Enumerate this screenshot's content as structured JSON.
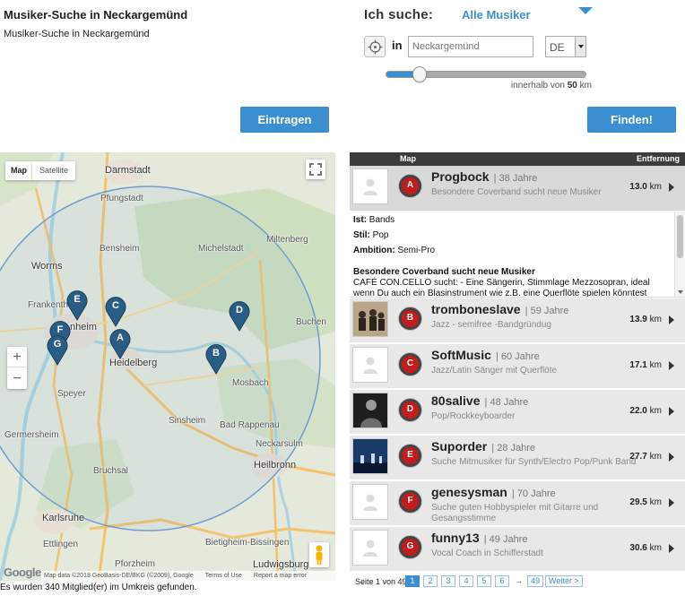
{
  "header": {
    "title": "Musiker-Suche in Neckargemünd",
    "subtitle": "Musiker-Suche in Neckargemünd"
  },
  "search": {
    "ich_suche_label": "Ich suche:",
    "category_value": "Alle Musiker",
    "in_label": "in",
    "location_placeholder": "Neckargemünd",
    "country_value": "DE",
    "radius_prefix": "innerhalb von",
    "radius_value": "50",
    "radius_unit": "km",
    "radius_fraction": 0.17,
    "eintragen_label": "Eintragen",
    "finden_label": "Finden!"
  },
  "map": {
    "type_map": "Map",
    "type_satellite": "Satellite",
    "zoom_in": "+",
    "zoom_out": "−",
    "google": "Google",
    "attribution": [
      "Map data ©2018 GeoBasis-DE/BKG (©2009), Google",
      "Terms of Use",
      "Report a map error"
    ],
    "cities": {
      "darmstadt": "Darmstadt",
      "pfungstadt": "Pfungstadt",
      "worms": "Worms",
      "bensheim": "Bensheim",
      "michelstadt": "Michelstadt",
      "miltenberg": "Miltenberg",
      "frankenthal": "Frankenth",
      "mannheim": "nheim",
      "heidelberg": "Heidelberg",
      "speyer": "Speyer",
      "mosbach": "Mosbach",
      "buchen": "Buchen",
      "sinsheim": "Sinsheim",
      "bad_rappenau": "Bad Rappenau",
      "germersheim": "Germersheim",
      "neckarsulm": "Neckarsulm",
      "bruchsal": "Bruchsal",
      "heilbronn": "Heilbronn",
      "karlsruhe": "Karlsruhe",
      "bietigheim": "Bietigheim-Bissingen",
      "ettlingen": "Ettlingen",
      "pforzheim": "Pforzheim",
      "ludwigsburg": "Ludwigsburg"
    },
    "pins": [
      "A",
      "B",
      "C",
      "D",
      "E",
      "F",
      "G"
    ]
  },
  "result_count_text": "Es wurden 340 Mitglied(er) im Umkreis gefunden.",
  "results": {
    "header_map": "Map",
    "header_distance": "Entfernung",
    "items": [
      {
        "letter": "A",
        "name": "Progbock",
        "age": "38 Jahre",
        "desc": "Besondere Coverband sucht neue Musiker",
        "dist": "13.0",
        "unit": "km"
      },
      {
        "letter": "B",
        "name": "tromboneslave",
        "age": "59 Jahre",
        "desc": "Jazz - semifree -Bandgründug",
        "dist": "13.9",
        "unit": "km"
      },
      {
        "letter": "C",
        "name": "SoftMusic",
        "age": "60 Jahre",
        "desc": "Jazz/Latin Sänger mit Querflöte",
        "dist": "17.1",
        "unit": "km"
      },
      {
        "letter": "D",
        "name": "80salive",
        "age": "48 Jahre",
        "desc": "Pop/Rockkeyboarder",
        "dist": "22.0",
        "unit": "km"
      },
      {
        "letter": "E",
        "name": "Suporder",
        "age": "28 Jahre",
        "desc": "Suche Mitmusiker für Synth/Electro Pop/Punk Band",
        "dist": "27.7",
        "unit": "km"
      },
      {
        "letter": "F",
        "name": "genesysman",
        "age": "70 Jahre",
        "desc": "Suche guten Hobbyspieler mit Gitarre und Gesangsstimme",
        "dist": "29.5",
        "unit": "km"
      },
      {
        "letter": "G",
        "name": "funny13",
        "age": "49 Jahre",
        "desc": "Vocal Coach in Schifferstadt",
        "dist": "30.6",
        "unit": "km"
      }
    ],
    "expanded": {
      "ist_label": "Ist:",
      "ist_value": "Bands",
      "stil_label": "Stil:",
      "stil_value": "Pop",
      "ambition_label": "Ambition:",
      "ambition_value": "Semi-Pro",
      "headline": "Besondere Coverband sucht neue Musiker",
      "text": "CAFÉ CON.CELLO sucht: - Eine Sängerin, Stimmlage Mezzosopran, ideal wenn Du auch ein Blasinstrument wie z.B. eine Querflöte spielen könntest"
    }
  },
  "pager": {
    "label": "Seite 1 von 49",
    "pages": [
      "1",
      "2",
      "3",
      "4",
      "5",
      "6"
    ],
    "arrow": "→",
    "last": "49",
    "next": "Weiter >"
  }
}
